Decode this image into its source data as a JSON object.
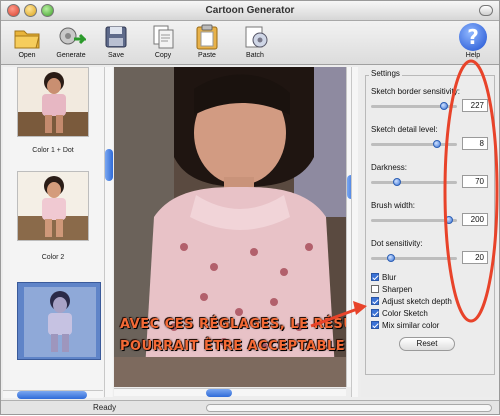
{
  "window": {
    "title": "Cartoon Generator"
  },
  "toolbar": {
    "items": [
      {
        "label": "Open",
        "icon": "folder-icon"
      },
      {
        "label": "Generate",
        "icon": "generate-icon"
      },
      {
        "label": "Save",
        "icon": "disk-icon"
      },
      {
        "label": "Copy",
        "icon": "copy-icon"
      },
      {
        "label": "Paste",
        "icon": "paste-icon"
      },
      {
        "label": "Batch",
        "icon": "batch-icon"
      }
    ],
    "help_label": "Help",
    "help_glyph": "?"
  },
  "thumbnails": [
    {
      "caption": "Color 1 + Dot"
    },
    {
      "caption": "Color 2"
    },
    {
      "caption": ""
    }
  ],
  "settings": {
    "title": "Settings",
    "sliders": [
      {
        "label": "Sketch border sensitivity:",
        "value": "227",
        "level": 0.89
      },
      {
        "label": "Sketch detail level:",
        "value": "8",
        "level": 0.8
      },
      {
        "label": "Darkness:",
        "value": "70",
        "level": 0.28
      },
      {
        "label": "Brush width:",
        "value": "200",
        "level": 0.95
      },
      {
        "label": "Dot sensitivity:",
        "value": "20",
        "level": 0.2
      }
    ],
    "checkboxes": [
      {
        "label": "Blur",
        "checked": true
      },
      {
        "label": "Sharpen",
        "checked": false
      },
      {
        "label": "Adjust sketch depth",
        "checked": true
      },
      {
        "label": "Color Sketch",
        "checked": true
      },
      {
        "label": "Mix similar color",
        "checked": true
      }
    ],
    "reset_label": "Reset"
  },
  "annotation": {
    "line1": "AVEC CES RÉGLAGES, LE RÉSULTAT",
    "line2": "POURRAIT ÊTRE ACCEPTABLE",
    "color": "#f46a36"
  },
  "status": {
    "text": "Ready"
  },
  "colors": {
    "accent": "#2f6bd8",
    "highlight": "#e8432a"
  }
}
